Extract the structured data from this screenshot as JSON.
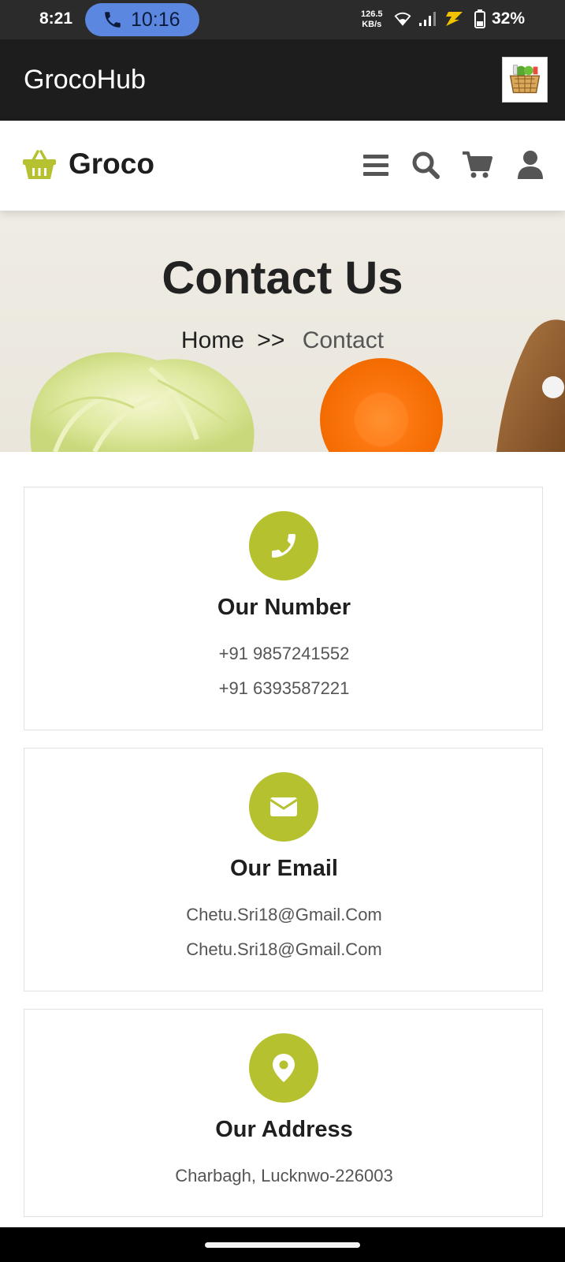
{
  "status_bar": {
    "time": "8:21",
    "call_time": "10:16",
    "net_speed_value": "126.5",
    "net_speed_unit": "KB/s",
    "battery_percent": "32%",
    "icons": [
      "call-icon",
      "wifi-icon",
      "signal-icon",
      "charging-bolt-icon",
      "battery-icon"
    ]
  },
  "app_bar": {
    "title": "GrocoHub",
    "logo_icon": "grocery-basket-logo"
  },
  "site_header": {
    "brand_name": "Groco",
    "brand_icon": "shopping-basket-icon",
    "icons": [
      "menu-icon",
      "search-icon",
      "cart-icon",
      "user-icon"
    ]
  },
  "hero": {
    "title": "Contact Us",
    "breadcrumb_home": "Home",
    "breadcrumb_separator": ">>",
    "breadcrumb_current": "Contact"
  },
  "cards": [
    {
      "icon": "phone-icon",
      "title": "Our Number",
      "lines": [
        "+91 9857241552",
        "+91 6393587221"
      ]
    },
    {
      "icon": "envelope-icon",
      "title": "Our Email",
      "lines": [
        "Chetu.Sri18@Gmail.Com",
        "Chetu.Sri18@Gmail.Com"
      ]
    },
    {
      "icon": "map-marker-icon",
      "title": "Our Address",
      "lines": [
        "Charbagh, Lucknwo-226003"
      ]
    }
  ],
  "colors": {
    "accent": "#b5c12f",
    "app_bar": "#1d1d1d",
    "status_bar": "#2b2b2b",
    "call_pill": "#5b87e0",
    "text_dark": "#1f1f1f",
    "text_muted": "#555555",
    "hero_bg": "#efece4"
  }
}
